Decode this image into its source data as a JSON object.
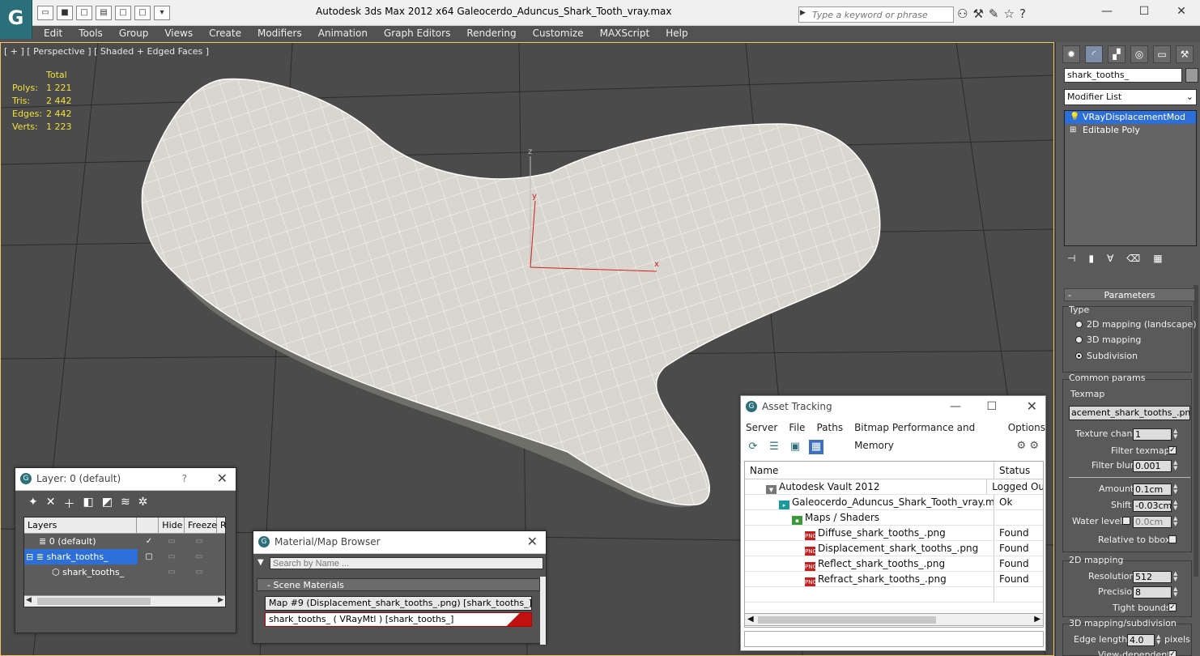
{
  "app": {
    "logo": "G",
    "window_title": "Autodesk 3ds Max  2012 x64     Galeocerdo_Aduncus_Shark_Tooth_vray.max",
    "search_placeholder": "Type a keyword or phrase"
  },
  "menu": [
    "Edit",
    "Tools",
    "Group",
    "Views",
    "Create",
    "Modifiers",
    "Animation",
    "Graph Editors",
    "Rendering",
    "Customize",
    "MAXScript",
    "Help"
  ],
  "viewport": {
    "label": "[ + ] [ Perspective ] [ Shaded + Edged Faces ]",
    "stats_header": "Total",
    "stats": [
      {
        "label": "Polys:",
        "value": "1 221"
      },
      {
        "label": "Tris:",
        "value": "2 442"
      },
      {
        "label": "Edges:",
        "value": "2 442"
      },
      {
        "label": "Verts:",
        "value": "1 223"
      }
    ],
    "gizmo": {
      "z": "z",
      "y": "y",
      "x": "x"
    }
  },
  "command_panel": {
    "object_name": "shark_tooths_",
    "modifier_list": "Modifier List",
    "stack": [
      "VRayDisplacementMod",
      "Editable Poly"
    ],
    "rollout": "Parameters",
    "type_label": "Type",
    "type_options": [
      "2D mapping (landscape)",
      "3D mapping",
      "Subdivision"
    ],
    "common_params": "Common params",
    "texmap_label": "Texmap",
    "texmap_value": "acement_shark_tooths_.png)",
    "texture_chan_label": "Texture chan",
    "texture_chan": "1",
    "filter_texmap": "Filter texmap",
    "filter_blur_label": "Filter blur",
    "filter_blur": "0.001",
    "amount_label": "Amount",
    "amount": "0.1cm",
    "shift_label": "Shift",
    "shift": "-0.03cm",
    "water_level_label": "Water level",
    "water_level": "0.0cm",
    "relative_bbox": "Relative to bbox",
    "mapping_2d": "2D mapping",
    "resolution_label": "Resolution",
    "resolution": "512",
    "precision_label": "Precision",
    "precision": "8",
    "tight_bounds": "Tight bounds",
    "mapping_3d": "3D mapping/subdivision",
    "edge_length_label": "Edge length",
    "edge_length": "4.0",
    "pixels": "pixels",
    "view_dependent": "View-dependent"
  },
  "layer_dialog": {
    "title": "Layer: 0 (default)",
    "help": "?",
    "columns": [
      "Layers",
      "Hide",
      "Freeze",
      "R"
    ],
    "rows": [
      "0 (default)",
      "shark_tooths_",
      "shark_tooths_"
    ]
  },
  "material_dialog": {
    "title": "Material/Map Browser",
    "search_placeholder": "Search by Name ...",
    "section": "- Scene Materials",
    "items": [
      "Map #9 (Displacement_shark_tooths_.png) [shark_tooths_]",
      "shark_tooths_  ( VRayMtl ) [shark_tooths_]"
    ]
  },
  "asset_dialog": {
    "title": "Asset Tracking",
    "menu": [
      "Server",
      "File",
      "Paths",
      "Bitmap Performance and Memory",
      "Options"
    ],
    "columns": [
      "Name",
      "Status"
    ],
    "rows": [
      {
        "name": "Autodesk Vault 2012",
        "status": "Logged Ou"
      },
      {
        "name": "Galeocerdo_Aduncus_Shark_Tooth_vray.max",
        "status": "Ok"
      },
      {
        "name": "Maps / Shaders",
        "status": ""
      },
      {
        "name": "Diffuse_shark_tooths_.png",
        "status": "Found"
      },
      {
        "name": "Displacement_shark_tooths_.png",
        "status": "Found"
      },
      {
        "name": "Reflect_shark_tooths_.png",
        "status": "Found"
      },
      {
        "name": "Refract_shark_tooths_.png",
        "status": "Found"
      }
    ]
  },
  "colors": {
    "accent": "#2d6fd8",
    "viewport_border": "#f3c36b",
    "stats": "#f0e040"
  }
}
